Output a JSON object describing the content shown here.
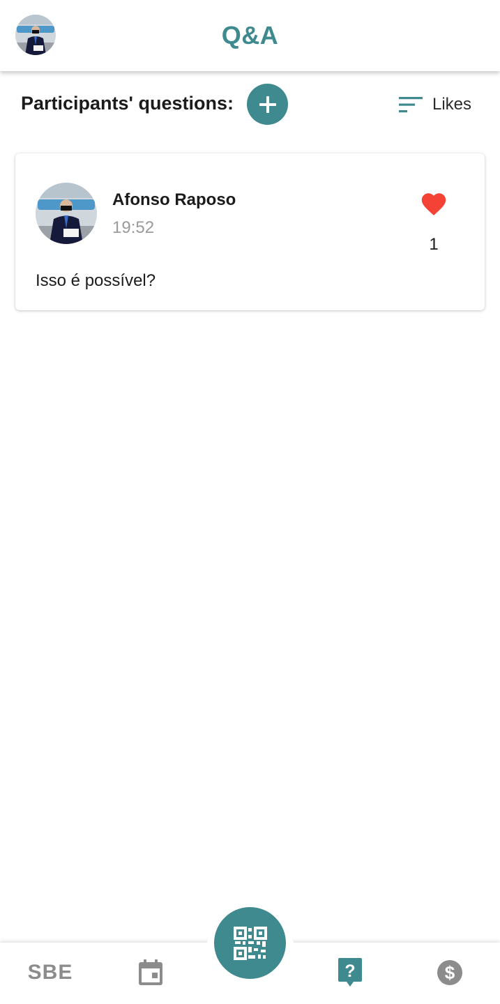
{
  "app": {
    "title": "Q&A"
  },
  "header": {
    "profile_avatar": "user-avatar"
  },
  "toolbar": {
    "section_title": "Participants' questions:",
    "add_icon": "plus-icon",
    "sort_icon": "sort-lines-icon",
    "sort_label": "Likes"
  },
  "questions": [
    {
      "author": "Afonso Raposo",
      "time": "19:52",
      "text": "Isso é possível?",
      "likes": "1",
      "liked": true
    }
  ],
  "bottom_nav": {
    "items": [
      {
        "label": "SBE",
        "icon": "sbe-logo"
      },
      {
        "icon": "calendar-icon"
      },
      {
        "icon": "qr-code-icon"
      },
      {
        "icon": "question-icon"
      },
      {
        "icon": "dollar-icon"
      }
    ]
  },
  "colors": {
    "accent": "#3f8a8e",
    "like": "#f44336",
    "inactive": "#8c8c8c"
  }
}
